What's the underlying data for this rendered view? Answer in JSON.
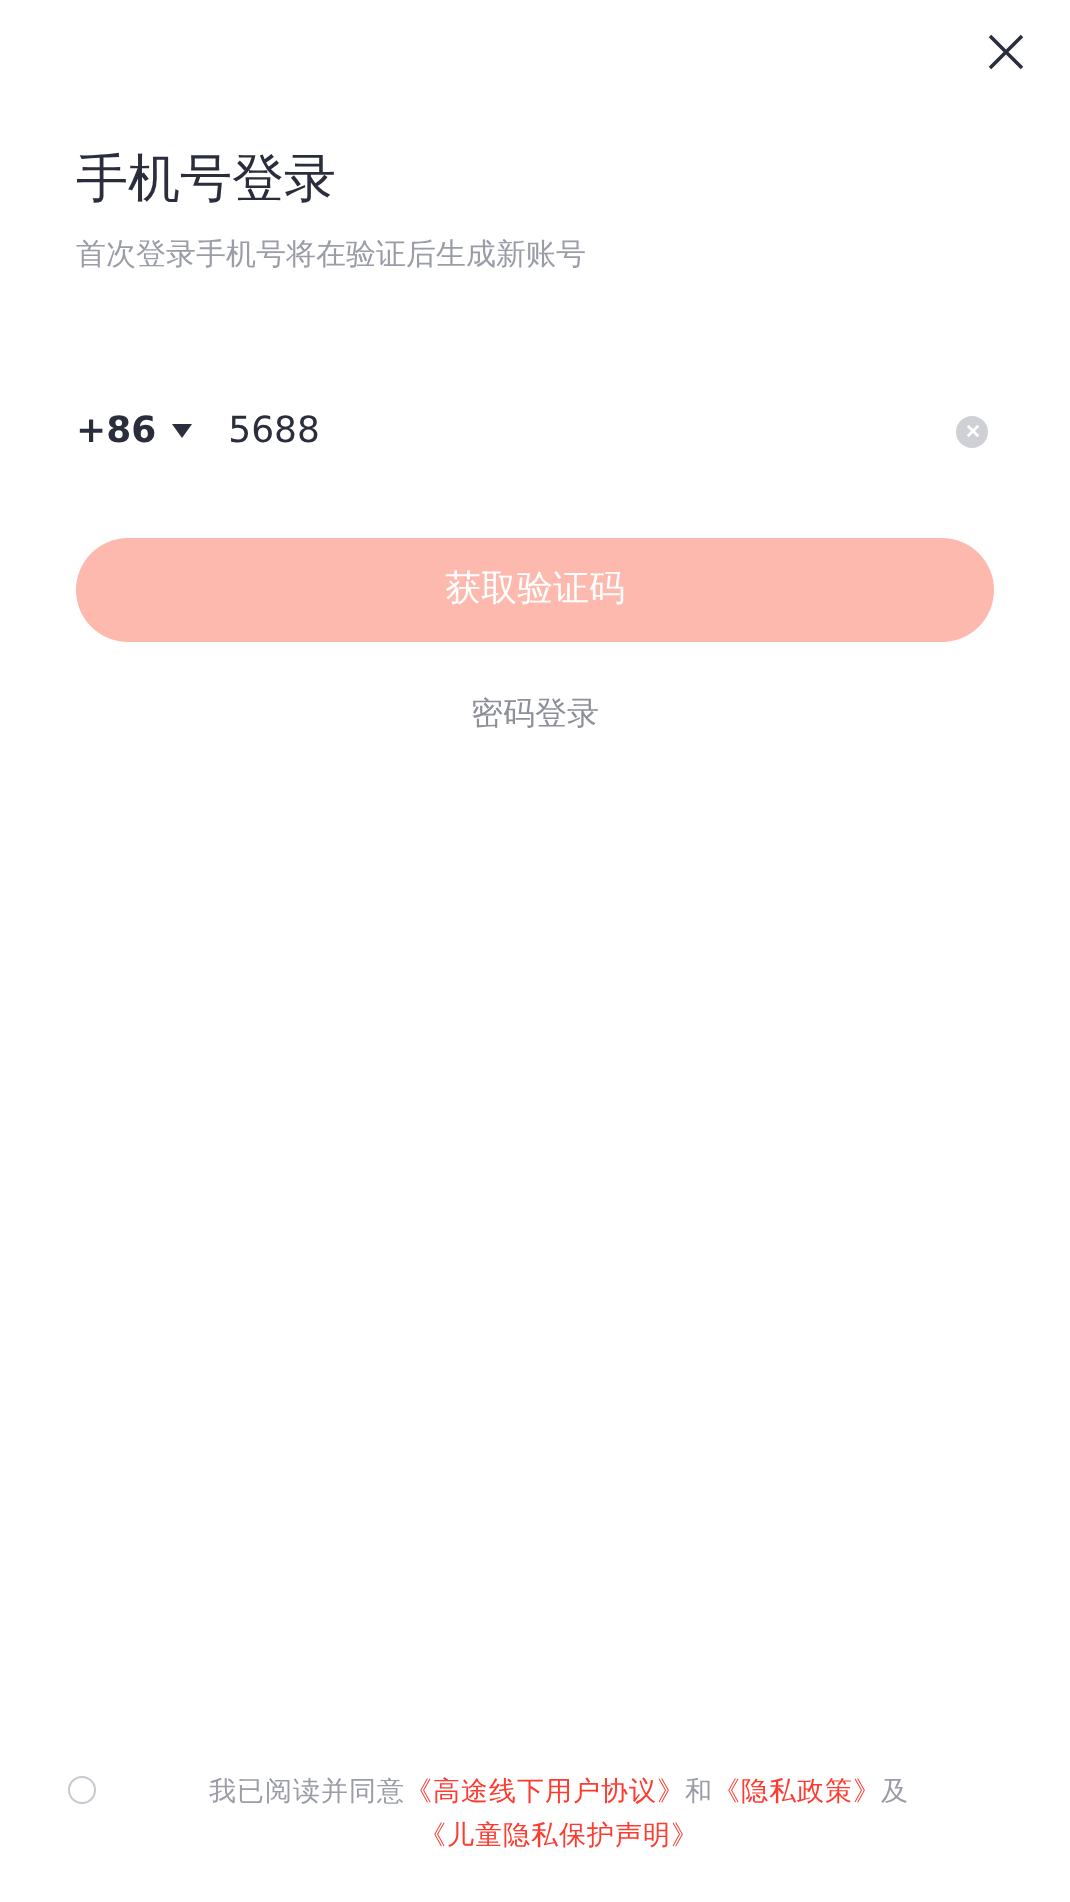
{
  "title": "手机号登录",
  "subtitle": "首次登录手机号将在验证后生成新账号",
  "phone": {
    "country_code": "+86",
    "value": "5688"
  },
  "submit_button": {
    "label": "获取验证码",
    "disabled": true
  },
  "alt_login": "密码登录",
  "agreement": {
    "checked": false,
    "parts": [
      {
        "kind": "text",
        "text": "我已阅读并同意"
      },
      {
        "kind": "link",
        "text": "《高途线下用户协议》"
      },
      {
        "kind": "text",
        "text": "和"
      },
      {
        "kind": "link",
        "text": "《隐私政策》"
      },
      {
        "kind": "text",
        "text": "及"
      },
      {
        "kind": "link",
        "text": "《儿童隐私保护声明》"
      }
    ]
  }
}
